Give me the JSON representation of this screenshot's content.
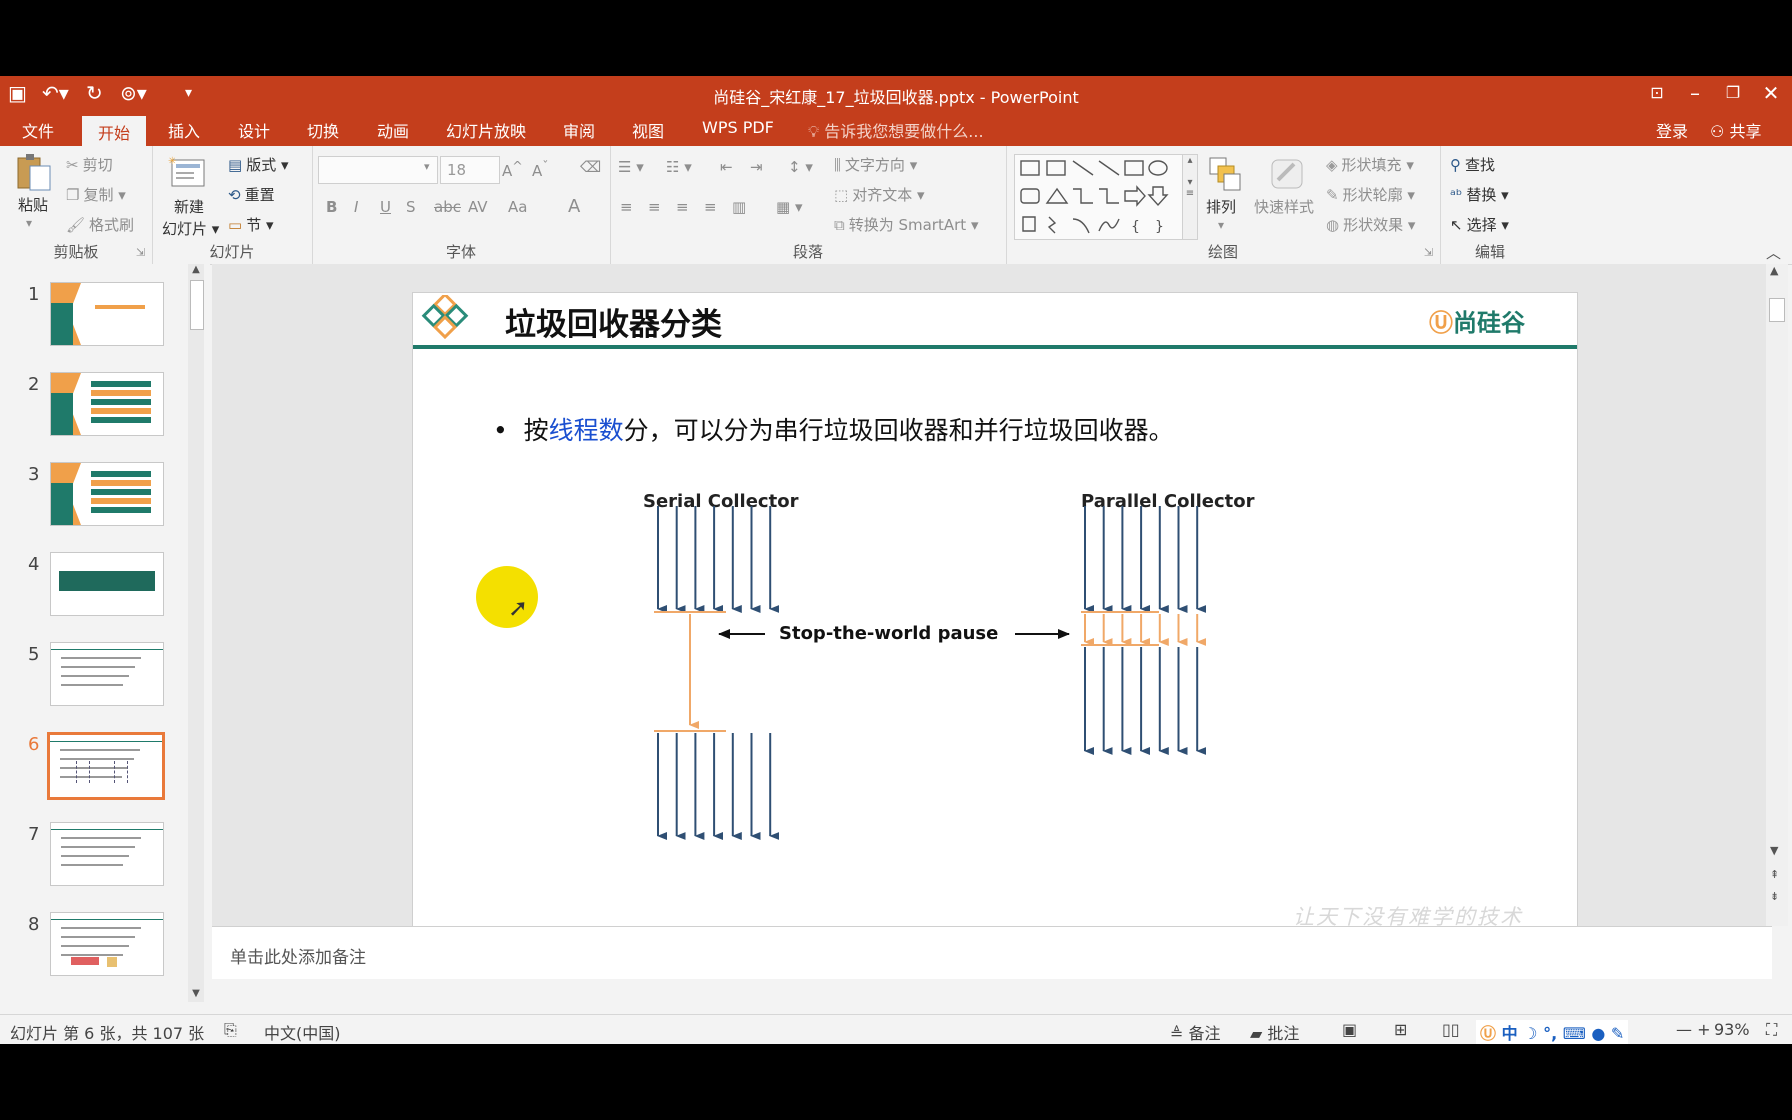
{
  "window": {
    "title": "尚硅谷_宋红康_17_垃圾回收器.pptx - PowerPoint"
  },
  "tabs": {
    "file": "文件",
    "home": "开始",
    "insert": "插入",
    "design": "设计",
    "transitions": "切换",
    "animations": "动画",
    "slideshow": "幻灯片放映",
    "review": "审阅",
    "view": "视图",
    "wpspdf": "WPS PDF",
    "tellme": "告诉我您想要做什么...",
    "login": "登录",
    "share": "共享"
  },
  "ribbon": {
    "clipboard": {
      "paste": "粘贴",
      "cut": "剪切",
      "copy": "复制",
      "format_painter": "格式刷",
      "label": "剪贴板"
    },
    "slides": {
      "new_slide_1": "新建",
      "new_slide_2": "幻灯片",
      "layout": "版式",
      "reset": "重置",
      "section": "节",
      "label": "幻灯片"
    },
    "font": {
      "size": "18",
      "label": "字体",
      "bold": "B",
      "italic": "I",
      "underline": "U",
      "shadow": "S",
      "strike": "abc",
      "spacing": "AV",
      "case": "Aa",
      "color": "A"
    },
    "paragraph": {
      "text_direction": "文字方向",
      "align_text": "对齐文本",
      "smartart": "转换为 SmartArt",
      "label": "段落"
    },
    "drawing": {
      "arrange": "排列",
      "quick_styles": "快速样式",
      "fill": "形状填充",
      "outline": "形状轮廓",
      "effects": "形状效果",
      "label": "绘图"
    },
    "editing": {
      "find": "查找",
      "replace": "替换",
      "select": "选择",
      "label": "编辑"
    }
  },
  "thumbnails": [
    {
      "num": "1"
    },
    {
      "num": "2"
    },
    {
      "num": "3"
    },
    {
      "num": "4"
    },
    {
      "num": "5"
    },
    {
      "num": "6"
    },
    {
      "num": "7"
    },
    {
      "num": "8"
    }
  ],
  "slide": {
    "title": "垃圾回收器分类",
    "logo": "尚硅谷",
    "bullet_prefix": "按",
    "bullet_highlight": "线程数",
    "bullet_rest": "分，可以分为串行垃圾回收器和并行垃圾回收器。",
    "serial_label": "Serial Collector",
    "parallel_label": "Parallel Collector",
    "pause_label": "Stop-the-world pause",
    "watermark": "让天下没有难学的技术",
    "colors": {
      "arrow": "#2f4f73",
      "pause": "#f0a868",
      "accent": "#1f7a6a"
    }
  },
  "notes": {
    "placeholder": "单击此处添加备注"
  },
  "status": {
    "slide_info": "幻灯片 第 6 张，共 107 张",
    "language": "中文(中国)",
    "notes": "备注",
    "comments": "批注",
    "zoom": "93%",
    "ime": "中"
  }
}
